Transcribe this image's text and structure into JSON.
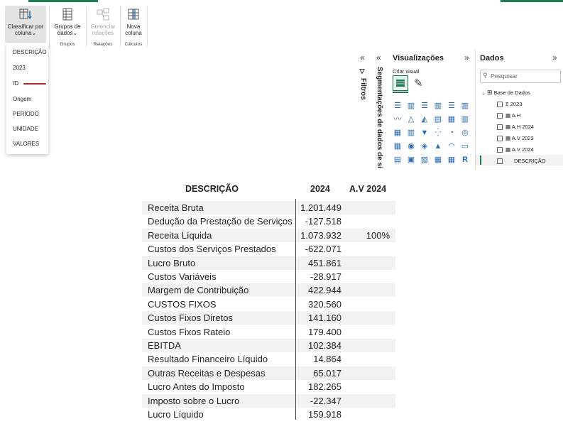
{
  "ribbon": {
    "buttons": [
      {
        "label_line1": "Classificar por",
        "label_line2": "coluna⌄"
      },
      {
        "label_line1": "Grupos de",
        "label_line2": "dados⌄"
      },
      {
        "label_line1": "Gerenciar",
        "label_line2": "relações"
      },
      {
        "label_line1": "Nova",
        "label_line2": "coluna"
      }
    ],
    "groups": [
      "Grupos",
      "Relações",
      "Cálculos"
    ]
  },
  "sort_menu": {
    "items": [
      "DESCRIÇÃO",
      "2023",
      "ID",
      "Origem",
      "PERÍODO",
      "UNIDADE",
      "VALORES"
    ]
  },
  "panes": {
    "filtros_label": "Filtros",
    "segmentacoes_label": "Segmentações de dados de si",
    "visualizacoes": {
      "title": "Visualizações",
      "create_visual": "Criar visual"
    },
    "dados": {
      "title": "Dados",
      "search_placeholder": "Pesquisar",
      "table_name": "Base de Dados",
      "fields": [
        "2023",
        "A.H",
        "A.H 2024",
        "A.V 2023",
        "A.V 2024",
        "DESCRIÇÃO"
      ]
    }
  },
  "table": {
    "headers": {
      "desc": "DESCRIÇÃO",
      "val": "2024",
      "av": "A.V 2024"
    },
    "rows": [
      {
        "desc": "Receita Bruta",
        "val": "1.201.449",
        "av": ""
      },
      {
        "desc": "Dedução da Prestação de Serviços",
        "val": "-127.518",
        "av": ""
      },
      {
        "desc": "Receita Líquida",
        "val": "1.073.932",
        "av": "100%"
      },
      {
        "desc": "Custos dos Serviços Prestados",
        "val": "-622.071",
        "av": ""
      },
      {
        "desc": "Lucro Bruto",
        "val": "451.861",
        "av": ""
      },
      {
        "desc": "Custos Variáveis",
        "val": "-28.917",
        "av": ""
      },
      {
        "desc": "Margem de Contribuição",
        "val": "422.944",
        "av": ""
      },
      {
        "desc": "CUSTOS FIXOS",
        "val": "320.560",
        "av": ""
      },
      {
        "desc": "Custos Fixos Diretos",
        "val": "141.160",
        "av": ""
      },
      {
        "desc": "Custos Fixos Rateio",
        "val": "179.400",
        "av": ""
      },
      {
        "desc": "EBITDA",
        "val": "102.384",
        "av": ""
      },
      {
        "desc": "Resultado Financeiro Líquido",
        "val": "14.864",
        "av": ""
      },
      {
        "desc": "Outras Receitas e Despesas",
        "val": "65.017",
        "av": ""
      },
      {
        "desc": "Lucro Antes do Imposto",
        "val": "182.265",
        "av": ""
      },
      {
        "desc": "Imposto sobre o Lucro",
        "val": "-22.347",
        "av": ""
      },
      {
        "desc": "Lucro Líquido",
        "val": "159.918",
        "av": ""
      }
    ]
  },
  "colors": {
    "accent": "#1e7b4f",
    "icon_blue": "#2b6cb0",
    "annotation_red": "#d42020"
  }
}
